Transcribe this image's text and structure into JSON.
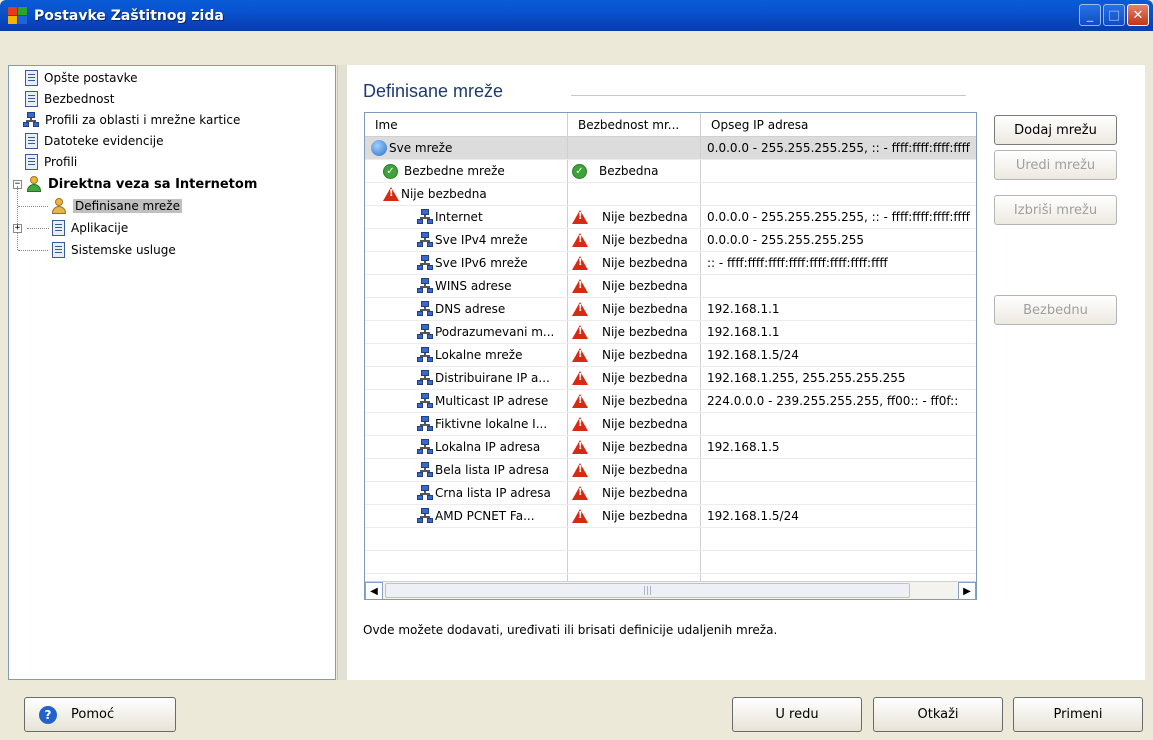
{
  "window": {
    "title": "Postavke Zaštitnog zida"
  },
  "tree": {
    "items": [
      {
        "label": "Opšte postavke"
      },
      {
        "label": "Bezbednost"
      },
      {
        "label": "Profili za oblasti i mrežne kartice"
      },
      {
        "label": "Datoteke evidencije"
      },
      {
        "label": "Profili"
      },
      {
        "label": "Direktna veza sa Internetom"
      },
      {
        "label": "Definisane mreže"
      },
      {
        "label": "Aplikacije"
      },
      {
        "label": "Sistemske usluge"
      }
    ]
  },
  "main": {
    "heading": "Definisane mreže",
    "columns": [
      "Ime",
      "Bezbednost mr...",
      "Opseg IP adresa"
    ],
    "rows": [
      {
        "name": "Sve mreže",
        "security": "",
        "range": "0.0.0.0 - 255.255.255.255, :: - ffff:ffff:ffff:ffff",
        "icon": "globe-icon"
      },
      {
        "name": "Bezbedne mreže",
        "security": "Bezbedna",
        "range": "",
        "icon": "check-icon"
      },
      {
        "name": "Nije bezbedna",
        "security": "",
        "range": "",
        "icon": "warning-icon"
      },
      {
        "name": "Internet",
        "security": "Nije bezbedna",
        "range": "0.0.0.0 - 255.255.255.255, :: - ffff:ffff:ffff:ffff",
        "icon": "network-icon"
      },
      {
        "name": "Sve IPv4 mreže",
        "security": "Nije bezbedna",
        "range": "0.0.0.0 - 255.255.255.255",
        "icon": "network-icon"
      },
      {
        "name": "Sve IPv6 mreže",
        "security": "Nije bezbedna",
        "range": ":: - ffff:ffff:ffff:ffff:ffff:ffff:ffff:ffff",
        "icon": "network-icon"
      },
      {
        "name": "WINS adrese",
        "security": "Nije bezbedna",
        "range": "",
        "icon": "network-icon"
      },
      {
        "name": "DNS adrese",
        "security": "Nije bezbedna",
        "range": "192.168.1.1",
        "icon": "network-icon"
      },
      {
        "name": "Podrazumevani m...",
        "security": "Nije bezbedna",
        "range": "192.168.1.1",
        "icon": "network-icon"
      },
      {
        "name": "Lokalne mreže",
        "security": "Nije bezbedna",
        "range": "192.168.1.5/24",
        "icon": "network-icon"
      },
      {
        "name": "Distribuirane IP a...",
        "security": "Nije bezbedna",
        "range": "192.168.1.255, 255.255.255.255",
        "icon": "network-icon"
      },
      {
        "name": "Multicast IP adrese",
        "security": "Nije bezbedna",
        "range": "224.0.0.0 - 239.255.255.255, ff00:: - ff0f::",
        "icon": "network-icon"
      },
      {
        "name": "Fiktivne lokalne I...",
        "security": "Nije bezbedna",
        "range": "",
        "icon": "network-icon"
      },
      {
        "name": "Lokalna IP adresa",
        "security": "Nije bezbedna",
        "range": "192.168.1.5",
        "icon": "network-icon"
      },
      {
        "name": "Bela lista IP adresa",
        "security": "Nije bezbedna",
        "range": "",
        "icon": "network-icon"
      },
      {
        "name": "Crna lista IP adresa",
        "security": "Nije bezbedna",
        "range": "",
        "icon": "network-icon"
      },
      {
        "name": "AMD PCNET Fa...",
        "security": "Nije bezbedna",
        "range": "192.168.1.5/24",
        "icon": "network-icon"
      }
    ],
    "description": "Ovde možete dodavati, uređivati ili brisati definicije udaljenih mreža."
  },
  "side_buttons": {
    "add": "Dodaj mrežu",
    "edit": "Uredi mrežu",
    "delete": "Izbriši mrežu",
    "safe": "Bezbednu"
  },
  "footer": {
    "help": "Pomoć",
    "ok": "U redu",
    "cancel": "Otkaži",
    "apply": "Primeni"
  },
  "colors": {
    "titlebar": "#0a53d0",
    "heading": "#1e3a6e",
    "warning": "#d82a12",
    "ok": "#3ea43a"
  }
}
